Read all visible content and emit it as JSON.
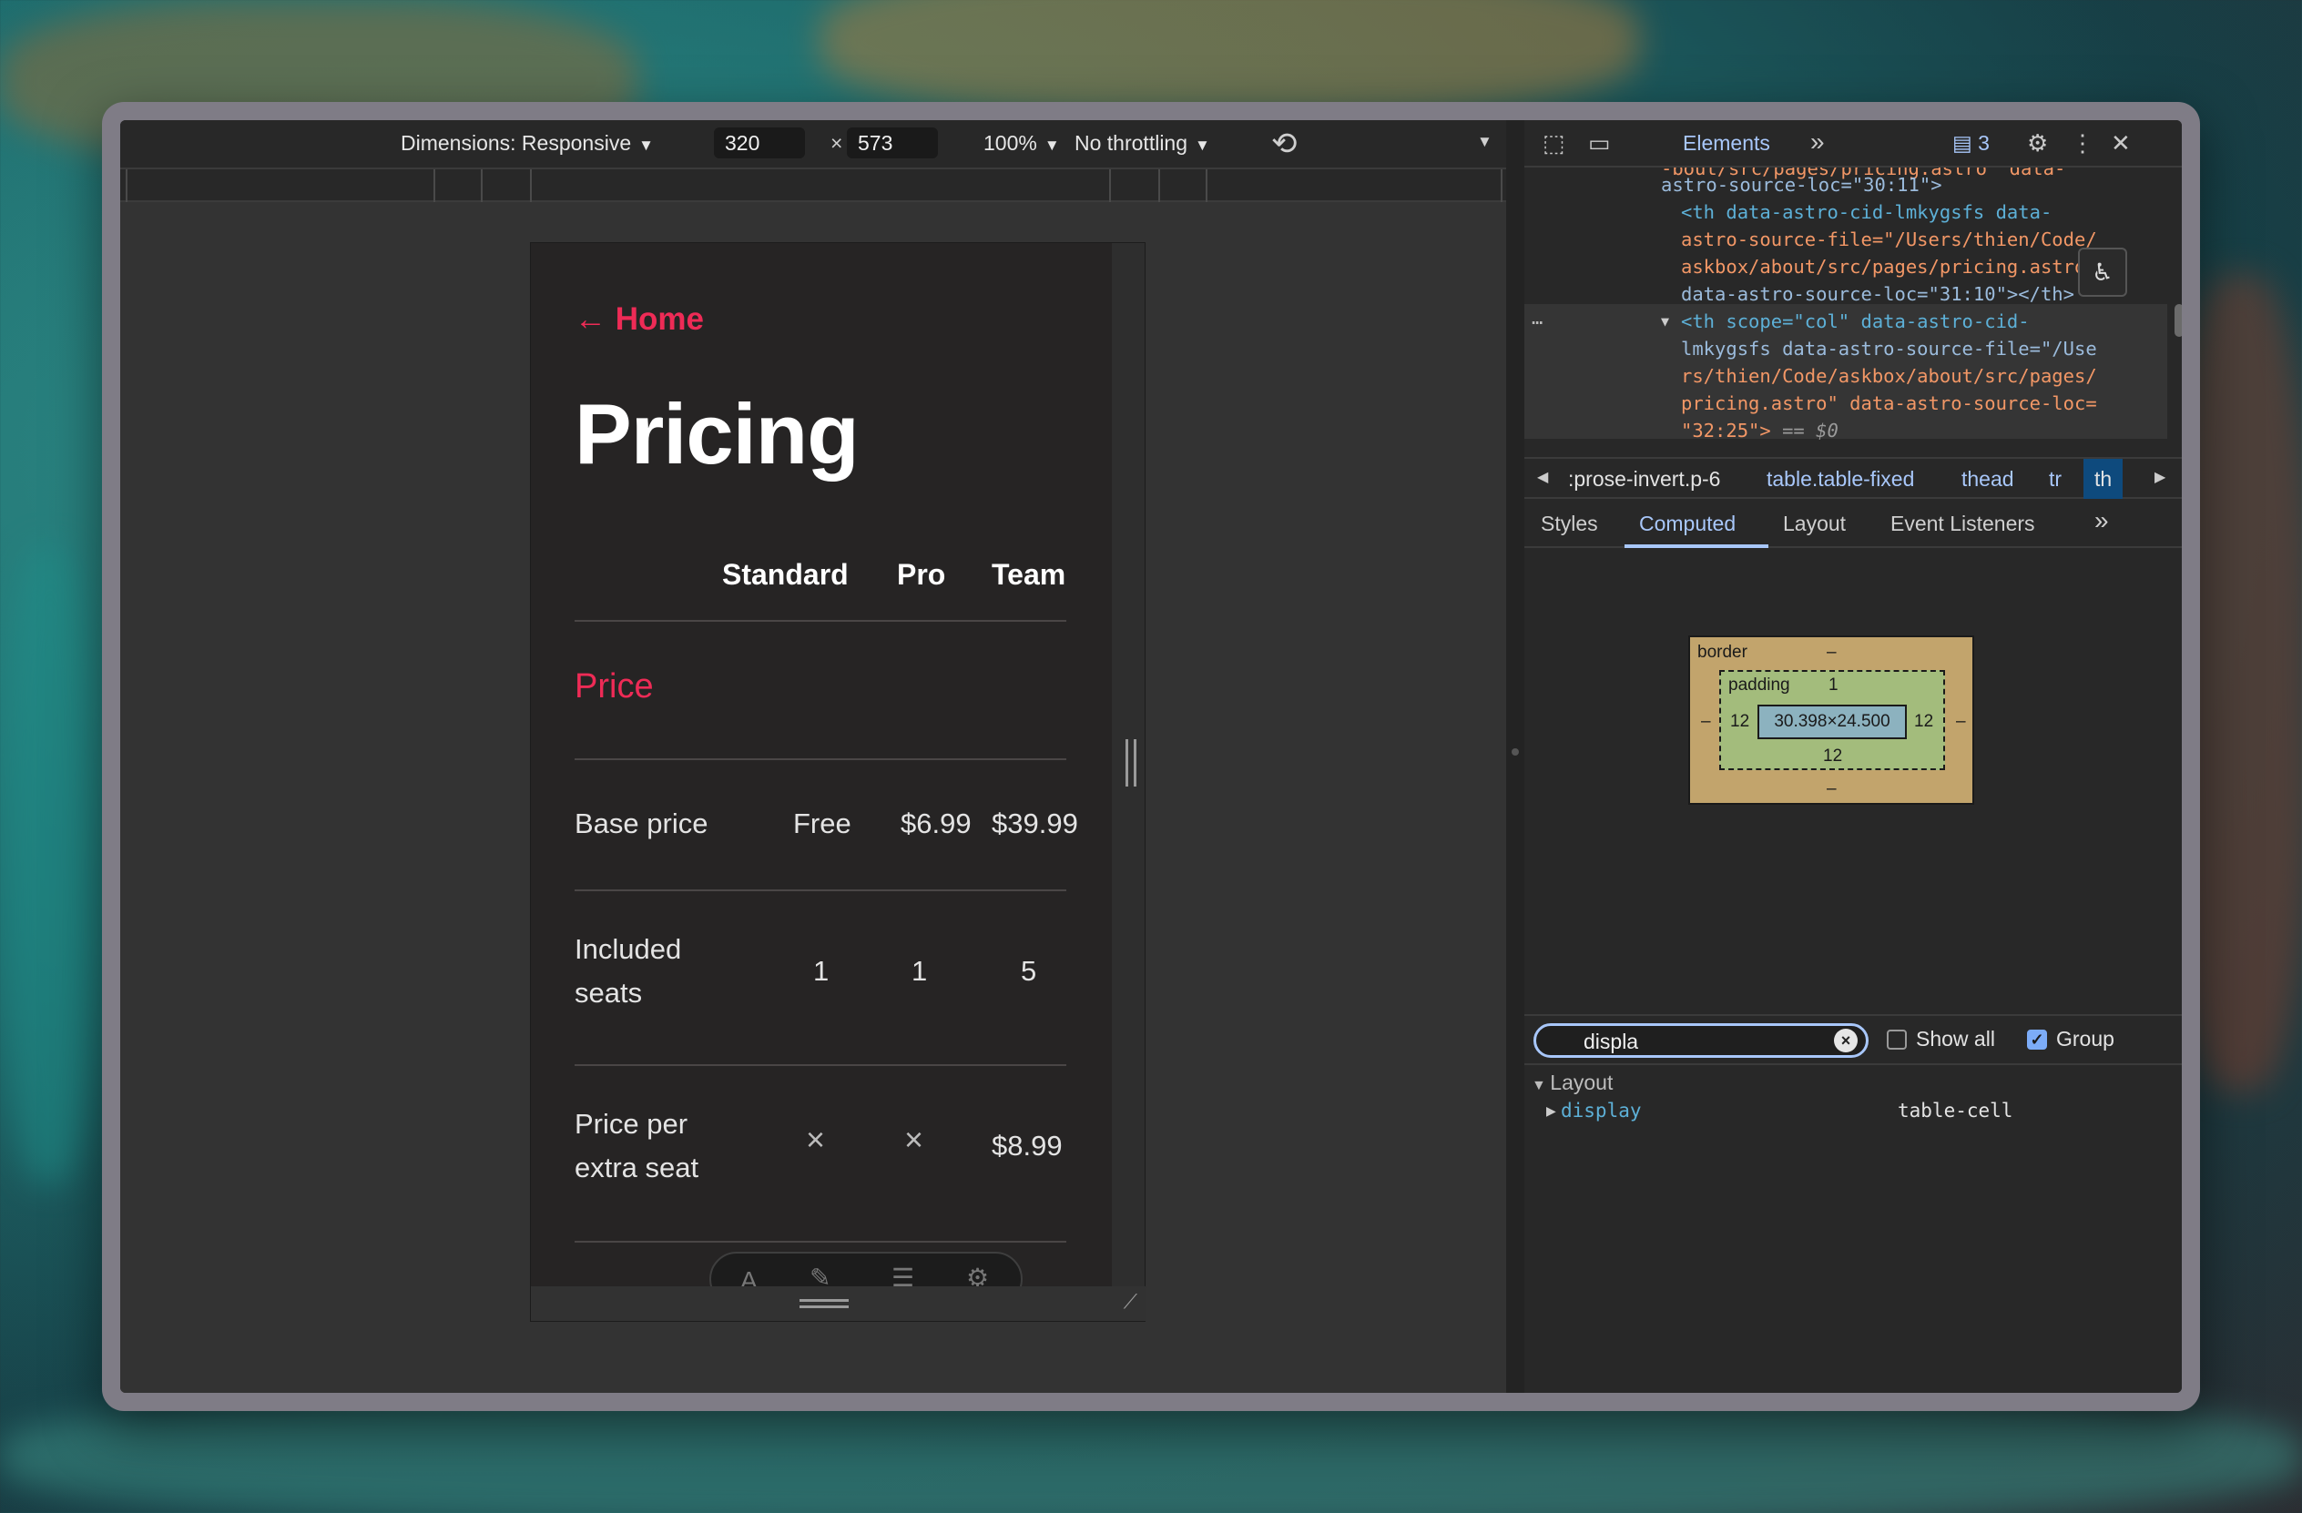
{
  "device_toolbar": {
    "dimensions_label": "Dimensions: Responsive",
    "width": "320",
    "times": "×",
    "height": "573",
    "zoom": "100%",
    "throttling": "No throttling"
  },
  "page": {
    "back_link": "← Home",
    "title": "Pricing",
    "columns": [
      "Standard",
      "Pro",
      "Team"
    ],
    "section": "Price",
    "rows": [
      {
        "label": "Base price",
        "values": [
          "Free",
          "$6.99",
          "$39.99"
        ]
      },
      {
        "label_line1": "Included",
        "label_line2": "seats",
        "values": [
          "1",
          "1",
          "5"
        ]
      },
      {
        "label_line1": "Price per",
        "label_line2": "extra seat",
        "values": [
          "×",
          "×",
          "$8.99"
        ]
      }
    ]
  },
  "devtools": {
    "main_tab": "Elements",
    "message_count": "3",
    "code_lines": {
      "l0": "-bout/src/pages/pricing.astro\" data-",
      "l1": "astro-source-loc=\"30:11\">",
      "l2a": "<th data-astro-cid-lmkygsfs data-",
      "l3a": "astro-source-file=\"/Users/thien/Code/",
      "l4a": "askbox/about/src/pages/pricing.astro\"",
      "l5a": "data-astro-source-loc=\"31:10\"></th>",
      "l6a": "<th scope=\"col\" data-astro-cid-",
      "l7a": "lmkygsfs data-astro-source-file=\"/Use",
      "l8a": "rs/thien/Code/askbox/about/src/pages/",
      "l9a": "pricing.astro\" data-astro-source-loc=",
      "l10a": "\"32:25\">",
      "l10b": "== $0"
    },
    "breadcrumbs": [
      ":prose-invert.p-6",
      "table.table-fixed",
      "thead",
      "tr",
      "th"
    ],
    "subtabs": [
      "Styles",
      "Computed",
      "Layout",
      "Event Listeners"
    ],
    "box_model": {
      "border_label": "border",
      "border_top": "–",
      "border_bottom": "–",
      "border_left": "–",
      "border_right": "–",
      "padding_label": "padding",
      "padding_top": "1",
      "padding_left": "12",
      "padding_right": "12",
      "padding_bottom": "12",
      "content": "30.398×24.500"
    },
    "filter": {
      "value": "displa",
      "show_all_label": "Show all",
      "show_all_checked": false,
      "group_label": "Group",
      "group_checked": true
    },
    "computed": {
      "group": "Layout",
      "property": "display",
      "value": "table-cell"
    }
  }
}
